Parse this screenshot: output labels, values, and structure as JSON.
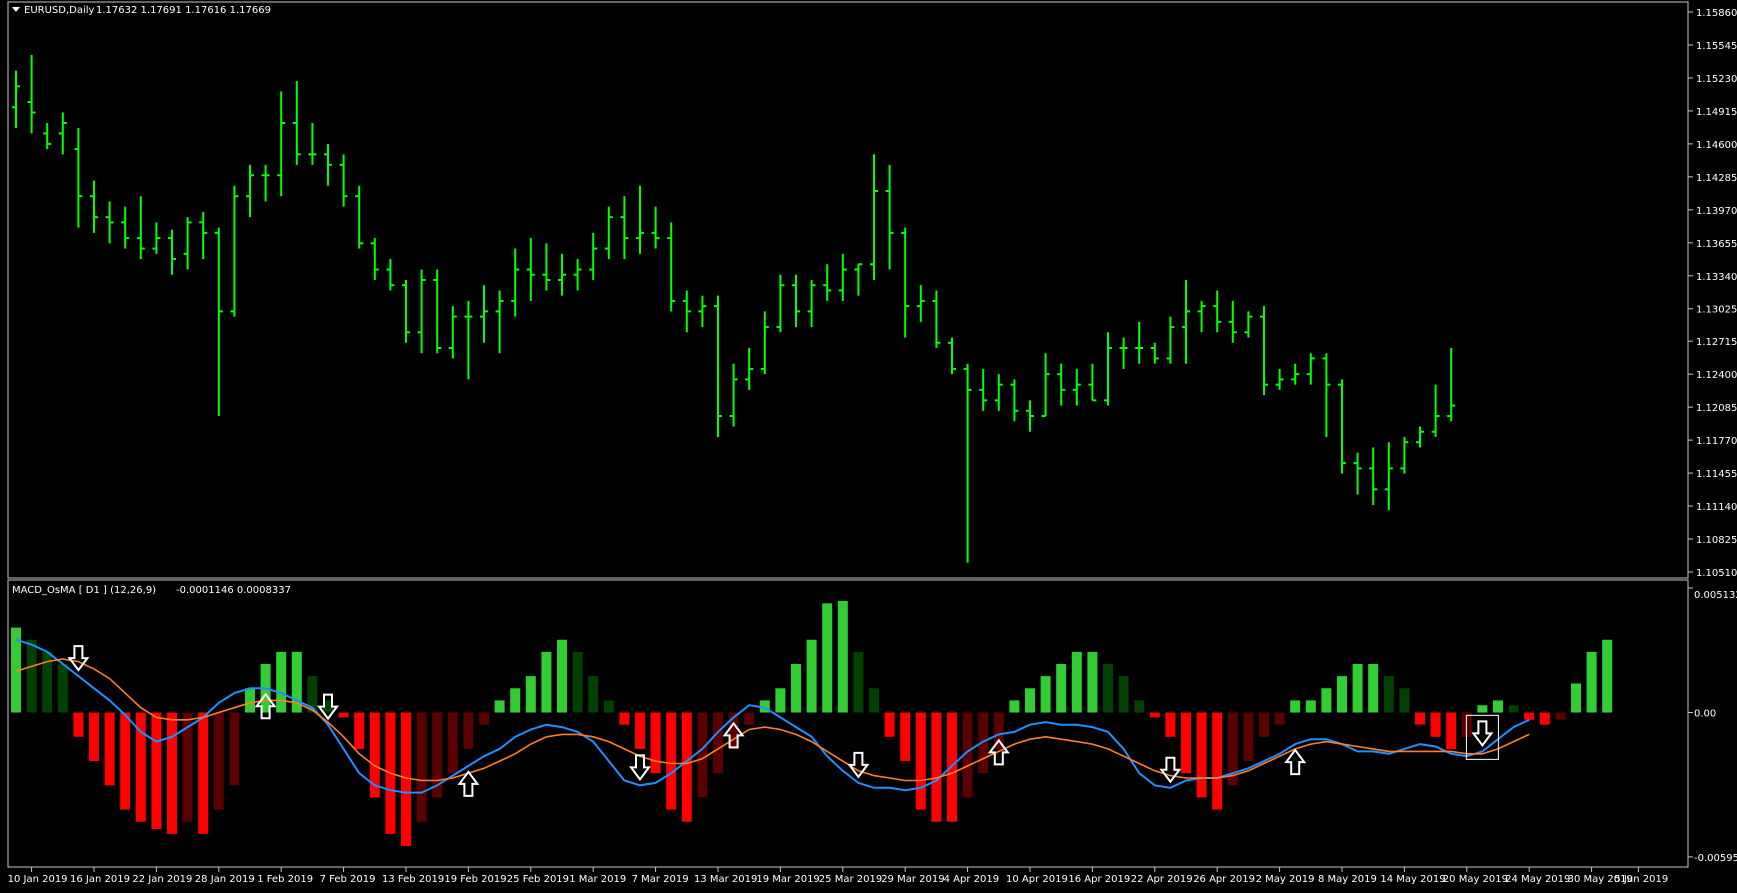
{
  "colors": {
    "background": "#000000",
    "frame": "#c8c8c8",
    "text": "#ffffff",
    "bar": "#00ff00",
    "hist_up_strong": "#32cd32",
    "hist_up_weak": "#004000",
    "hist_down_strong": "#ff0000",
    "hist_down_weak": "#5a0000",
    "macd_line": "#1e90ff",
    "signal_line": "#ff7f27",
    "arrow": "#ffffff"
  },
  "header": {
    "symbol": "EURUSD,Daily",
    "ohlc": "1.17632 1.17691 1.17616 1.17669",
    "collapse_icon": "triangle-down-icon"
  },
  "indicator": {
    "name": "MACD_OsMA [ D1 ] (12,26,9)",
    "values": "-0.0001146 0.0008337"
  },
  "chart_data": [
    {
      "type": "ohlc",
      "title": "EURUSD,Daily",
      "ylim": [
        1.1051,
        1.1586
      ],
      "y_ticks": [
        "1.15860",
        "1.15545",
        "1.15230",
        "1.14915",
        "1.14600",
        "1.14285",
        "1.13970",
        "1.13655",
        "1.13340",
        "1.13025",
        "1.12715",
        "1.12400",
        "1.12085",
        "1.11770",
        "1.11455",
        "1.11140",
        "1.10825",
        "1.10510"
      ],
      "x_ticks": [
        {
          "i": 1,
          "label": "10 Jan 2019"
        },
        {
          "i": 5,
          "label": "16 Jan 2019"
        },
        {
          "i": 9,
          "label": "22 Jan 2019"
        },
        {
          "i": 13,
          "label": "28 Jan 2019"
        },
        {
          "i": 17,
          "label": "1 Feb 2019"
        },
        {
          "i": 21,
          "label": "7 Feb 2019"
        },
        {
          "i": 25,
          "label": "13 Feb 2019"
        },
        {
          "i": 29,
          "label": "19 Feb 2019"
        },
        {
          "i": 33,
          "label": "25 Feb 2019"
        },
        {
          "i": 37,
          "label": "1 Mar 2019"
        },
        {
          "i": 41,
          "label": "7 Mar 2019"
        },
        {
          "i": 45,
          "label": "13 Mar 2019"
        },
        {
          "i": 49,
          "label": "19 Mar 2019"
        },
        {
          "i": 53,
          "label": "25 Mar 2019"
        },
        {
          "i": 57,
          "label": "29 Mar 2019"
        },
        {
          "i": 61,
          "label": "4 Apr 2019"
        },
        {
          "i": 65,
          "label": "10 Apr 2019"
        },
        {
          "i": 69,
          "label": "16 Apr 2019"
        },
        {
          "i": 73,
          "label": "22 Apr 2019"
        },
        {
          "i": 77,
          "label": "26 Apr 2019"
        },
        {
          "i": 81,
          "label": "2 May 2019"
        },
        {
          "i": 85,
          "label": "8 May 2019"
        },
        {
          "i": 89,
          "label": "14 May 2019"
        },
        {
          "i": 93,
          "label": "20 May 2019"
        },
        {
          "i": 97,
          "label": "24 May 2019"
        },
        {
          "i": 101,
          "label": "30 May 2019"
        },
        {
          "i": 104,
          "label": "5 Jun 2019"
        }
      ],
      "bars": [
        [
          1.1495,
          1.153,
          1.1475,
          1.1515
        ],
        [
          1.15,
          1.1545,
          1.147,
          1.149
        ],
        [
          1.147,
          1.148,
          1.1455,
          1.146
        ],
        [
          1.147,
          1.149,
          1.145,
          1.148
        ],
        [
          1.1455,
          1.1475,
          1.138,
          1.141
        ],
        [
          1.141,
          1.1425,
          1.1375,
          1.139
        ],
        [
          1.139,
          1.1405,
          1.1365,
          1.1385
        ],
        [
          1.1385,
          1.14,
          1.136,
          1.137
        ],
        [
          1.137,
          1.141,
          1.135,
          1.136
        ],
        [
          1.136,
          1.1385,
          1.1355,
          1.137
        ],
        [
          1.137,
          1.1378,
          1.1335,
          1.135
        ],
        [
          1.1355,
          1.139,
          1.134,
          1.1385
        ],
        [
          1.1385,
          1.1395,
          1.135,
          1.1375
        ],
        [
          1.1375,
          1.138,
          1.12,
          1.13
        ],
        [
          1.13,
          1.142,
          1.1295,
          1.141
        ],
        [
          1.141,
          1.144,
          1.139,
          1.143
        ],
        [
          1.143,
          1.144,
          1.1405,
          1.143
        ],
        [
          1.143,
          1.151,
          1.141,
          1.148
        ],
        [
          1.148,
          1.152,
          1.144,
          1.145
        ],
        [
          1.145,
          1.148,
          1.144,
          1.145
        ],
        [
          1.145,
          1.146,
          1.142,
          1.144
        ],
        [
          1.144,
          1.145,
          1.14,
          1.141
        ],
        [
          1.141,
          1.142,
          1.136,
          1.1365
        ],
        [
          1.1365,
          1.137,
          1.133,
          1.134
        ],
        [
          1.134,
          1.135,
          1.132,
          1.1325
        ],
        [
          1.1325,
          1.133,
          1.127,
          1.128
        ],
        [
          1.128,
          1.134,
          1.126,
          1.133
        ],
        [
          1.133,
          1.134,
          1.126,
          1.1265
        ],
        [
          1.1265,
          1.1305,
          1.1255,
          1.1295
        ],
        [
          1.1295,
          1.131,
          1.1235,
          1.1295
        ],
        [
          1.1295,
          1.1325,
          1.127,
          1.13
        ],
        [
          1.13,
          1.132,
          1.126,
          1.131
        ],
        [
          1.131,
          1.136,
          1.1295,
          1.134
        ],
        [
          1.134,
          1.137,
          1.131,
          1.1335
        ],
        [
          1.1335,
          1.1365,
          1.132,
          1.133
        ],
        [
          1.133,
          1.1355,
          1.1315,
          1.1335
        ],
        [
          1.1335,
          1.135,
          1.132,
          1.134
        ],
        [
          1.134,
          1.1375,
          1.133,
          1.136
        ],
        [
          1.136,
          1.14,
          1.135,
          1.139
        ],
        [
          1.139,
          1.141,
          1.135,
          1.137
        ],
        [
          1.137,
          1.142,
          1.1355,
          1.1375
        ],
        [
          1.1375,
          1.14,
          1.136,
          1.137
        ],
        [
          1.137,
          1.1385,
          1.13,
          1.131
        ],
        [
          1.131,
          1.132,
          1.128,
          1.13
        ],
        [
          1.13,
          1.1315,
          1.1285,
          1.1305
        ],
        [
          1.1305,
          1.1315,
          1.118,
          1.12
        ],
        [
          1.12,
          1.125,
          1.119,
          1.1235
        ],
        [
          1.1235,
          1.1265,
          1.1225,
          1.1245
        ],
        [
          1.1245,
          1.13,
          1.124,
          1.1285
        ],
        [
          1.1285,
          1.1335,
          1.128,
          1.1325
        ],
        [
          1.1325,
          1.1335,
          1.1285,
          1.13
        ],
        [
          1.13,
          1.133,
          1.1285,
          1.1325
        ],
        [
          1.1325,
          1.1345,
          1.131,
          1.132
        ],
        [
          1.132,
          1.1355,
          1.131,
          1.134
        ],
        [
          1.134,
          1.1345,
          1.1315,
          1.1345
        ],
        [
          1.1345,
          1.145,
          1.133,
          1.1415
        ],
        [
          1.1415,
          1.144,
          1.134,
          1.1375
        ],
        [
          1.1375,
          1.138,
          1.1275,
          1.1305
        ],
        [
          1.1305,
          1.1325,
          1.129,
          1.131
        ],
        [
          1.131,
          1.132,
          1.1265,
          1.127
        ],
        [
          1.127,
          1.1275,
          1.124,
          1.1245
        ],
        [
          1.1245,
          1.125,
          1.106,
          1.1225
        ],
        [
          1.1225,
          1.1245,
          1.1205,
          1.1215
        ],
        [
          1.1215,
          1.124,
          1.1205,
          1.123
        ],
        [
          1.123,
          1.1235,
          1.1195,
          1.1205
        ],
        [
          1.1205,
          1.1215,
          1.1185,
          1.12
        ],
        [
          1.12,
          1.126,
          1.12,
          1.124
        ],
        [
          1.124,
          1.125,
          1.121,
          1.1225
        ],
        [
          1.1225,
          1.1245,
          1.121,
          1.123
        ],
        [
          1.123,
          1.125,
          1.1215,
          1.1215
        ],
        [
          1.1215,
          1.128,
          1.121,
          1.1265
        ],
        [
          1.1265,
          1.1275,
          1.1245,
          1.1265
        ],
        [
          1.1265,
          1.129,
          1.125,
          1.1265
        ],
        [
          1.1265,
          1.127,
          1.125,
          1.1255
        ],
        [
          1.1255,
          1.1295,
          1.125,
          1.1285
        ],
        [
          1.1285,
          1.133,
          1.125,
          1.13
        ],
        [
          1.13,
          1.131,
          1.128,
          1.1305
        ],
        [
          1.1305,
          1.132,
          1.128,
          1.129
        ],
        [
          1.129,
          1.131,
          1.127,
          1.128
        ],
        [
          1.128,
          1.13,
          1.1275,
          1.1295
        ],
        [
          1.1295,
          1.1305,
          1.122,
          1.123
        ],
        [
          1.123,
          1.1245,
          1.1225,
          1.1235
        ],
        [
          1.1235,
          1.125,
          1.123,
          1.124
        ],
        [
          1.124,
          1.126,
          1.123,
          1.1255
        ],
        [
          1.1255,
          1.126,
          1.118,
          1.123
        ],
        [
          1.123,
          1.1235,
          1.1145,
          1.1155
        ],
        [
          1.1155,
          1.1165,
          1.1125,
          1.115
        ],
        [
          1.115,
          1.117,
          1.1115,
          1.113
        ],
        [
          1.113,
          1.1175,
          1.111,
          1.115
        ],
        [
          1.115,
          1.118,
          1.1145,
          1.1175
        ],
        [
          1.1175,
          1.119,
          1.117,
          1.1185
        ],
        [
          1.1185,
          1.123,
          1.118,
          1.12
        ],
        [
          1.12,
          1.1265,
          1.1195,
          1.121
        ]
      ]
    },
    {
      "type": "bar",
      "title": "MACD_OsMA [ D1 ] (12,26,9)",
      "ylim": [
        -0.005995,
        0.005132
      ],
      "y_ticks": [
        "0.005132",
        "0.00",
        "-0.005950"
      ],
      "hist": [
        0.0035,
        0.003,
        0.0025,
        0.002,
        -0.001,
        -0.002,
        -0.003,
        -0.004,
        -0.0045,
        -0.0048,
        -0.005,
        -0.0045,
        -0.005,
        -0.004,
        -0.003,
        0.001,
        0.002,
        0.0025,
        0.0025,
        0.0015,
        0.0005,
        -0.0002,
        -0.0015,
        -0.0035,
        -0.005,
        -0.0055,
        -0.0045,
        -0.0035,
        -0.0025,
        -0.0015,
        -0.0005,
        0.0005,
        0.001,
        0.0015,
        0.0025,
        0.003,
        0.0025,
        0.0015,
        0.0005,
        -0.0005,
        -0.0015,
        -0.0025,
        -0.004,
        -0.0045,
        -0.0035,
        -0.0025,
        -0.0015,
        -0.0005,
        0.0005,
        0.001,
        0.002,
        0.003,
        0.0045,
        0.0046,
        0.0025,
        0.001,
        -0.001,
        -0.002,
        -0.004,
        -0.0045,
        -0.0045,
        -0.0035,
        -0.0025,
        -0.0015,
        0.0005,
        0.001,
        0.0015,
        0.002,
        0.0025,
        0.0025,
        0.002,
        0.0015,
        0.0005,
        -0.0002,
        -0.001,
        -0.0025,
        -0.0035,
        -0.004,
        -0.003,
        -0.002,
        -0.001,
        -0.0005,
        0.0005,
        0.0005,
        0.001,
        0.0015,
        0.002,
        0.002,
        0.0015,
        0.001,
        -0.0005,
        -0.001,
        -0.0015,
        -0.001,
        0.0003,
        0.0005,
        0.0003,
        -0.0003,
        -0.0005,
        -0.0003,
        0.0012,
        0.0025,
        0.003
      ],
      "macd": [
        0.003,
        0.0028,
        0.0025,
        0.002,
        0.0015,
        0.001,
        0.0005,
        -0.0001,
        -0.0008,
        -0.0012,
        -0.001,
        -0.0006,
        -0.0002,
        0.0004,
        0.0008,
        0.001,
        0.001,
        0.0008,
        0.0005,
        0.0002,
        -0.0005,
        -0.0015,
        -0.0025,
        -0.003,
        -0.0032,
        -0.0033,
        -0.0033,
        -0.003,
        -0.0026,
        -0.0022,
        -0.0018,
        -0.0015,
        -0.001,
        -0.0007,
        -0.0005,
        -0.0006,
        -0.0008,
        -0.0012,
        -0.002,
        -0.0028,
        -0.003,
        -0.0029,
        -0.0025,
        -0.002,
        -0.0015,
        -0.0008,
        -0.0002,
        0.0003,
        0.0002,
        -0.0002,
        -0.0006,
        -0.001,
        -0.0018,
        -0.0024,
        -0.0029,
        -0.0031,
        -0.0031,
        -0.0032,
        -0.0031,
        -0.0028,
        -0.0022,
        -0.0016,
        -0.0012,
        -0.0009,
        -0.0008,
        -0.0005,
        -0.0004,
        -0.0005,
        -0.0005,
        -0.0006,
        -0.0008,
        -0.0015,
        -0.0025,
        -0.003,
        -0.0031,
        -0.0028,
        -0.0027,
        -0.0027,
        -0.0025,
        -0.0023,
        -0.002,
        -0.0017,
        -0.0013,
        -0.0011,
        -0.0011,
        -0.0013,
        -0.0016,
        -0.0016,
        -0.0017,
        -0.0015,
        -0.0013,
        -0.0014,
        -0.0017,
        -0.0018,
        -0.0016,
        -0.0011,
        -0.0006,
        -0.0003
      ],
      "signal": [
        0.0017,
        0.0019,
        0.0021,
        0.0022,
        0.0021,
        0.0018,
        0.0014,
        0.0008,
        0.0002,
        -0.0002,
        -0.0003,
        -0.0003,
        -0.0002,
        0.0,
        0.0002,
        0.0004,
        0.0005,
        0.0005,
        0.0004,
        0.0001,
        -0.0004,
        -0.001,
        -0.0017,
        -0.0022,
        -0.0025,
        -0.0027,
        -0.0028,
        -0.0028,
        -0.0027,
        -0.0025,
        -0.0023,
        -0.002,
        -0.0017,
        -0.0013,
        -0.001,
        -0.0009,
        -0.0009,
        -0.001,
        -0.0012,
        -0.0015,
        -0.0018,
        -0.002,
        -0.0021,
        -0.0021,
        -0.0019,
        -0.0015,
        -0.0011,
        -0.0007,
        -0.0006,
        -0.0007,
        -0.0009,
        -0.0012,
        -0.0016,
        -0.002,
        -0.0024,
        -0.0026,
        -0.0027,
        -0.0028,
        -0.0028,
        -0.0027,
        -0.0025,
        -0.0022,
        -0.0019,
        -0.0016,
        -0.0013,
        -0.0011,
        -0.001,
        -0.0011,
        -0.0012,
        -0.0013,
        -0.0015,
        -0.0018,
        -0.0021,
        -0.0024,
        -0.0026,
        -0.0027,
        -0.0027,
        -0.0027,
        -0.0026,
        -0.0024,
        -0.0021,
        -0.0018,
        -0.0015,
        -0.0013,
        -0.0012,
        -0.0013,
        -0.0014,
        -0.0015,
        -0.0016,
        -0.0016,
        -0.0016,
        -0.0016,
        -0.0016,
        -0.0017,
        -0.0017,
        -0.0015,
        -0.0012,
        -0.0009
      ],
      "signals": [
        {
          "i": 4,
          "dir": "down"
        },
        {
          "i": 16,
          "dir": "up"
        },
        {
          "i": 20,
          "dir": "down"
        },
        {
          "i": 29,
          "dir": "up"
        },
        {
          "i": 40,
          "dir": "down"
        },
        {
          "i": 46,
          "dir": "up"
        },
        {
          "i": 54,
          "dir": "down"
        },
        {
          "i": 63,
          "dir": "up"
        },
        {
          "i": 74,
          "dir": "down"
        },
        {
          "i": 82,
          "dir": "up"
        },
        {
          "i": 94,
          "dir": "down"
        }
      ],
      "highlight_index": 94
    }
  ]
}
